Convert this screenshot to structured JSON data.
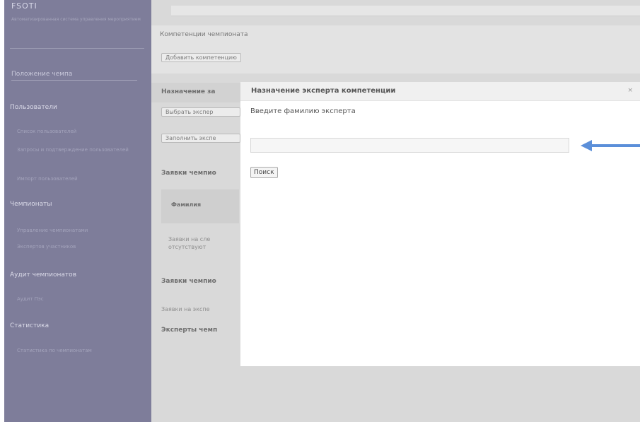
{
  "sidebar": {
    "brand": "FSOTI",
    "brand_subtitle": "Автоматизированная система управления мероприятием",
    "section_button": "Положение чемпа",
    "users": {
      "heading": "Пользователи",
      "items": [
        "Список пользователей",
        "Запросы и подтверждение пользователей",
        "Импорт пользователей"
      ]
    },
    "championships": {
      "heading": "Чемпионаты",
      "items": [
        "Управление чемпионатами",
        "Экспертов участников"
      ]
    },
    "audit": {
      "heading": "Аудит чемпионатов",
      "items": [
        "Аудит Пэс"
      ]
    },
    "stats": {
      "heading": "Статистика",
      "items": [
        "Статистика по чемпионатам"
      ]
    }
  },
  "main": {
    "page_title": "Компетенции чемпионата",
    "add_competency_button": "Добавить компетенцию",
    "assign_label": "Назначение за",
    "select_expert_button": "Выбрать экспер",
    "fill_expert_button": "Заполнить экспе",
    "applications_label": "Заявки чемпио",
    "surname_column": "Фамилия",
    "no_applications_text": [
      "Заявки на сле",
      "отсутствуют"
    ],
    "applications_label_2": "Заявки чемпио",
    "expert_applications_text": "Заявки на экспе",
    "experts_label": "Эксперты чемп"
  },
  "modal": {
    "title": "Назначение эксперта компетенции",
    "close": "×",
    "prompt": "Введите фамилию эксперта",
    "input_value": "",
    "search_button": "Поиск"
  },
  "colors": {
    "sidebar_bg": "#7e7d9a",
    "arrow": "#5b8fd9"
  }
}
